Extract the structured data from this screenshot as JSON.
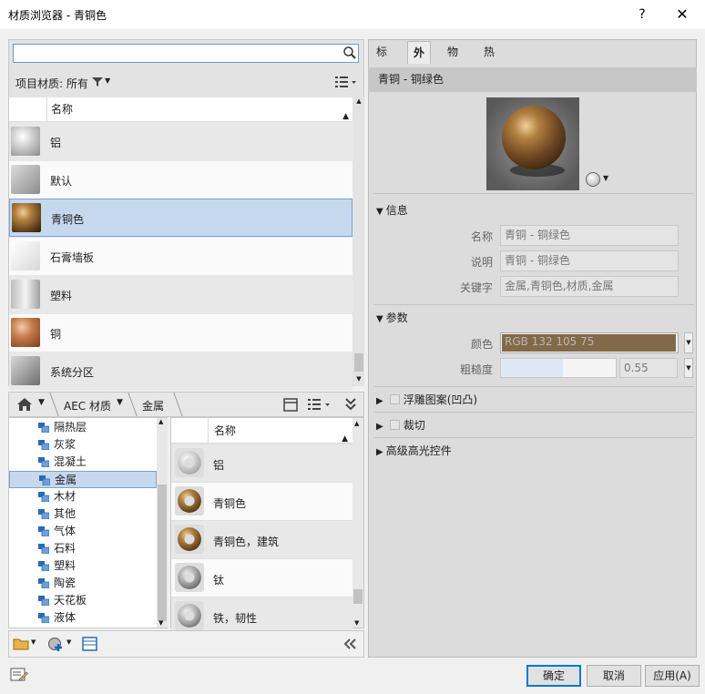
{
  "window": {
    "title": "材质浏览器 - 青铜色",
    "help": "?",
    "close": "✕"
  },
  "search": {
    "placeholder": "",
    "value": ""
  },
  "project_filter": {
    "label": "项目材质: 所有"
  },
  "materials_header": {
    "name": "名称"
  },
  "materials": [
    {
      "name": "铝",
      "thumb": "aluminum"
    },
    {
      "name": "默认",
      "thumb": "default"
    },
    {
      "name": "青铜色",
      "thumb": "bronze",
      "selected": true
    },
    {
      "name": "石膏墙板",
      "thumb": "gypsum"
    },
    {
      "name": "塑料",
      "thumb": "plastic"
    },
    {
      "name": "铜",
      "thumb": "copper"
    },
    {
      "name": "系统分区",
      "thumb": "system"
    }
  ],
  "library_bar": {
    "home": "home-icon",
    "breadcrumb_1": "AEC 材质",
    "breadcrumb_2": "金属"
  },
  "library_tree": [
    {
      "label": "隔热层"
    },
    {
      "label": "灰浆"
    },
    {
      "label": "混凝土"
    },
    {
      "label": "金属",
      "selected": true
    },
    {
      "label": "木材"
    },
    {
      "label": "其他"
    },
    {
      "label": "气体"
    },
    {
      "label": "石料"
    },
    {
      "label": "塑料"
    },
    {
      "label": "陶瓷"
    },
    {
      "label": "天花板"
    },
    {
      "label": "液体"
    }
  ],
  "library_list_header": {
    "name": "名称"
  },
  "library_list": [
    {
      "name": "铝",
      "thumb": "aluminum"
    },
    {
      "name": "青铜色",
      "thumb": "bronze"
    },
    {
      "name": "青铜色，建筑",
      "thumb": "bronze"
    },
    {
      "name": "钛",
      "thumb": "titanium"
    },
    {
      "name": "铁，韧性",
      "thumb": "iron"
    }
  ],
  "tabs": [
    {
      "label": "标识"
    },
    {
      "label": "外观",
      "active": true
    },
    {
      "label": "物理"
    },
    {
      "label": "热度"
    }
  ],
  "asset": {
    "title": "青铜 - 铜绿色"
  },
  "info": {
    "header": "信息",
    "name_label": "名称",
    "name_value": "青铜 - 铜绿色",
    "desc_label": "说明",
    "desc_value": "青铜 - 铜绿色",
    "kw_label": "关键字",
    "kw_value": "金属,青铜色,材质,金属"
  },
  "params": {
    "header": "参数",
    "color_label": "颜色",
    "color_value": "RGB 132 105 75",
    "color_hex": "#846949",
    "rough_label": "粗糙度",
    "rough_value": "0.55",
    "rough_fraction": 0.55
  },
  "sections": {
    "relief": "浮雕图案(凹凸)",
    "cutout": "裁切",
    "highlight": "高级高光控件"
  },
  "buttons": {
    "ok": "确定",
    "cancel": "取消",
    "apply": "应用(A)"
  }
}
